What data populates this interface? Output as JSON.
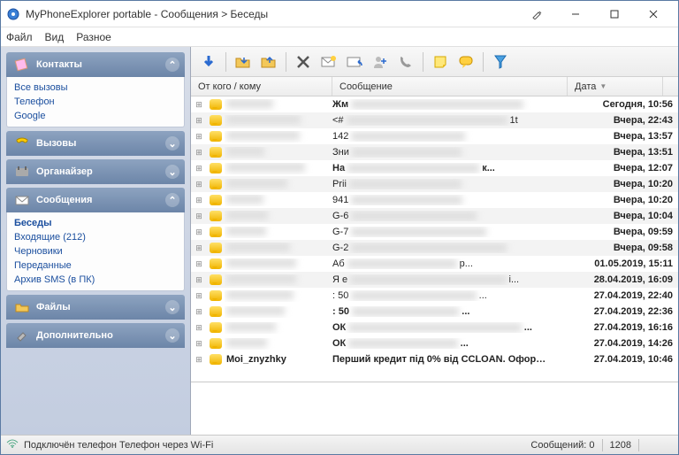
{
  "title": "MyPhoneExplorer portable -  Сообщения > Беседы",
  "menu": {
    "file": "Файл",
    "view": "Вид",
    "misc": "Разное"
  },
  "sidebar": {
    "contacts": {
      "header": "Контакты",
      "items": [
        "Все вызовы",
        "Телефон",
        "Google"
      ]
    },
    "calls": {
      "header": "Вызовы"
    },
    "organizer": {
      "header": "Органайзер"
    },
    "messages": {
      "header": "Сообщения",
      "items": [
        "Беседы",
        "Входящие (212)",
        "Черновики",
        "Переданные",
        "Архив SMS (в ПК)"
      ]
    },
    "files": {
      "header": "Файлы"
    },
    "extra": {
      "header": "Дополнительно"
    }
  },
  "columns": {
    "from": "От кого / кому",
    "msg": "Сообщение",
    "date": "Дата"
  },
  "rows": [
    {
      "from": "",
      "msg": "Жм",
      "date": "Сегодня, 10:56",
      "bold": true
    },
    {
      "from": "",
      "msg": "<#",
      "msgSuffix": "1t",
      "date": "Вчера, 22:43"
    },
    {
      "from": "",
      "msg": "142",
      "date": "Вчера, 13:57"
    },
    {
      "from": "",
      "msg": "Зни",
      "date": "Вчера, 13:51"
    },
    {
      "from": "",
      "msg": "На",
      "msgSuffix": "к...",
      "date": "Вчера, 12:07",
      "bold": true
    },
    {
      "from": "",
      "msg": "Prii",
      "date": "Вчера, 10:20"
    },
    {
      "from": "",
      "msg": "941",
      "date": "Вчера, 10:20"
    },
    {
      "from": "",
      "msg": "G-6",
      "date": "Вчера, 10:04"
    },
    {
      "from": "",
      "msg": "G-7",
      "date": "Вчера, 09:59"
    },
    {
      "from": "",
      "msg": "G-2",
      "date": "Вчера, 09:58"
    },
    {
      "from": "",
      "msg": "Аб",
      "msgSuffix": "р...",
      "date": "01.05.2019, 15:11"
    },
    {
      "from": "",
      "msg": "Я е",
      "msgSuffix": "і...",
      "date": "28.04.2019, 16:09"
    },
    {
      "from": "",
      "msg": ": 50",
      "msgSuffix": "...",
      "date": "27.04.2019, 22:40"
    },
    {
      "from": "",
      "msg": ": 50",
      "msgSuffix": "...",
      "date": "27.04.2019, 22:36",
      "bold": true
    },
    {
      "from": "",
      "msg": "ОК",
      "msgSuffix": "...",
      "date": "27.04.2019, 16:16",
      "bold": true
    },
    {
      "from": "",
      "msg": "ОК",
      "msgSuffix": "...",
      "date": "27.04.2019, 14:26",
      "bold": true
    },
    {
      "from": "Moi_znyzhky",
      "msg": "Перший кредит під 0% від CCLOAN. Офор…",
      "date": "27.04.2019, 10:46",
      "bold": true,
      "noblur": true
    }
  ],
  "status": {
    "conn": "Подключён телефон Телефон через Wi-Fi",
    "msgCount": "Сообщений: 0",
    "total": "1208"
  }
}
